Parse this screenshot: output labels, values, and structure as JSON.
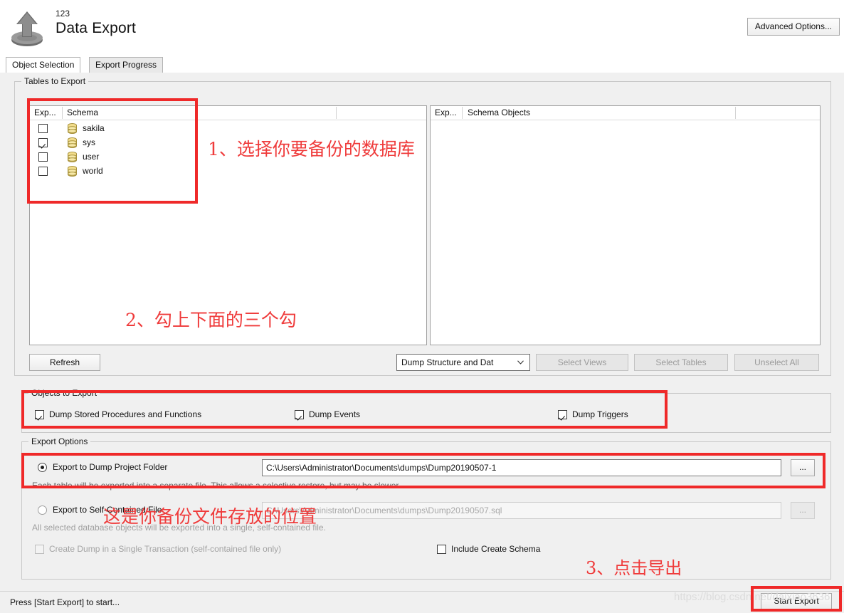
{
  "header": {
    "number": "123",
    "title": "Data Export",
    "advanced_options_label": "Advanced Options...",
    "icon": "upload-arrow-icon"
  },
  "tabs": [
    {
      "label": "Object Selection",
      "active": true
    },
    {
      "label": "Export Progress",
      "active": false
    }
  ],
  "tables_to_export": {
    "group_label": "Tables to Export",
    "left_list": {
      "columns": [
        "Exp...",
        "Schema"
      ],
      "rows": [
        {
          "checked": false,
          "icon": "database-icon",
          "label": "sakila"
        },
        {
          "checked": true,
          "icon": "database-icon",
          "label": "sys"
        },
        {
          "checked": false,
          "icon": "database-icon",
          "label": "user"
        },
        {
          "checked": false,
          "icon": "database-icon",
          "label": "world"
        }
      ]
    },
    "right_list": {
      "columns": [
        "Exp...",
        "Schema Objects"
      ],
      "rows": []
    },
    "refresh_label": "Refresh",
    "dump_mode": "Dump Structure and Dat",
    "select_views_label": "Select Views",
    "select_tables_label": "Select Tables",
    "unselect_all_label": "Unselect All"
  },
  "objects_to_export": {
    "group_label": "Objects to Export",
    "items": [
      {
        "label": "Dump Stored Procedures and Functions",
        "checked": true
      },
      {
        "label": "Dump Events",
        "checked": true
      },
      {
        "label": "Dump Triggers",
        "checked": true
      }
    ]
  },
  "export_options": {
    "group_label": "Export Options",
    "folder_radio_label": "Export to Dump Project Folder",
    "folder_path": "C:\\Users\\Administrator\\Documents\\dumps\\Dump20190507-1",
    "folder_hint": "Each table will be exported into a separate file. This allows a selective restore, but may be slower.",
    "file_radio_label": "Export to Self-Contained File",
    "file_path": "C:\\Users\\Administrator\\Documents\\dumps\\Dump20190507.sql",
    "file_hint": "All selected database objects will be exported into a single, self-contained file.",
    "browse_label": "...",
    "single_transaction_label": "Create Dump in a Single Transaction (self-contained file only)",
    "include_create_schema_label": "Include Create Schema",
    "single_transaction_checked": false,
    "include_create_schema_checked": false,
    "folder_selected": true
  },
  "statusbar": {
    "message": "Press [Start Export] to start...",
    "start_export_label": "Start Export"
  },
  "annotations": [
    {
      "id": 1,
      "text": "1、选择你要备份的数据库"
    },
    {
      "id": 2,
      "text": "2、勾上下面的三个勾"
    },
    {
      "id": 3,
      "text": "3、点击导出"
    },
    {
      "id": 4,
      "text": "这是你备份文件存放的位置"
    }
  ],
  "watermark": "https://blog.csdn.net/daixiao3636",
  "colors": {
    "annotation_red": "#ef3b3b",
    "highlight_box": "#ef2929",
    "window_bg": "#f0f0f0"
  }
}
